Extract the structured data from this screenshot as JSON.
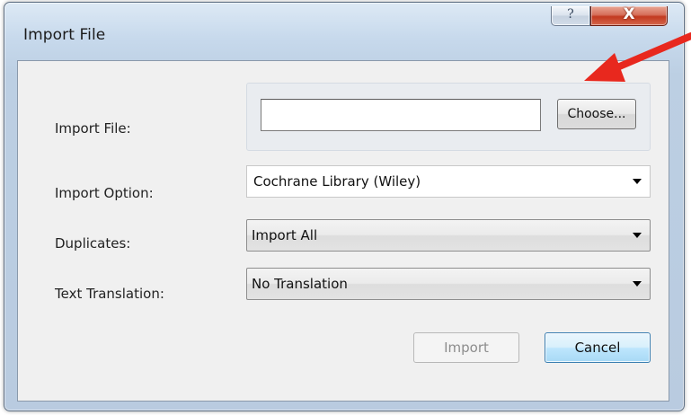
{
  "window": {
    "title": "Import File",
    "help_glyph": "?",
    "close_glyph": "X"
  },
  "form": {
    "import_file": {
      "label": "Import File:",
      "value": "",
      "choose_label": "Choose..."
    },
    "import_option": {
      "label": "Import Option:",
      "selected": "Cochrane Library (Wiley)"
    },
    "duplicates": {
      "label": "Duplicates:",
      "selected": "Import All"
    },
    "text_translation": {
      "label": "Text Translation:",
      "selected": "No Translation"
    }
  },
  "buttons": {
    "import_label": "Import",
    "import_enabled": false,
    "cancel_label": "Cancel"
  },
  "annotation": {
    "arrow_color": "#e8281e",
    "points_to": "choose-button"
  },
  "icons": {
    "help": "help-icon",
    "close": "close-icon",
    "dropdown": "chevron-down-icon",
    "annotation": "arrow-annotation-icon"
  }
}
